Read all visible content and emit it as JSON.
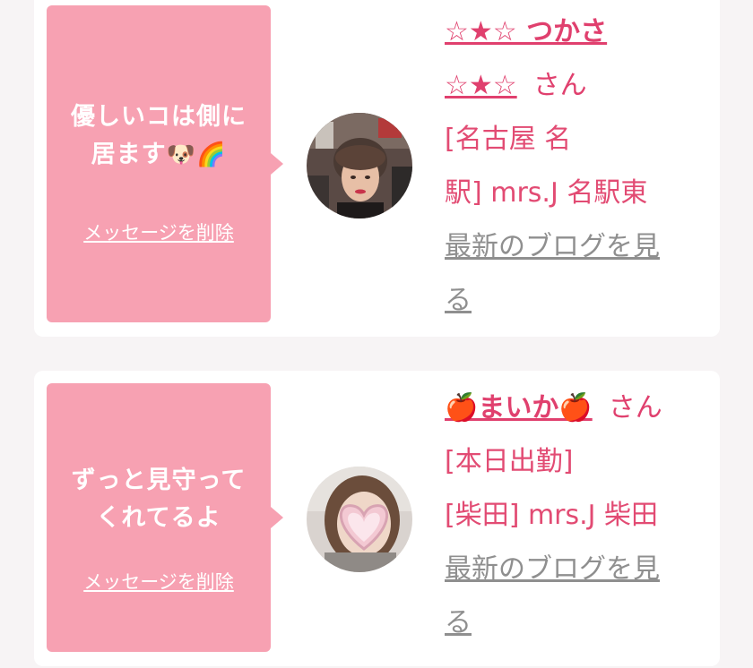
{
  "cards": [
    {
      "message": "優しいコは側に居ます🐶🌈",
      "message_line1": "優しいコは側に",
      "message_line2": "居ます",
      "message_emoji": "🐶🌈",
      "delete_label": "メッセージを削除",
      "name_line1": "☆★☆ つかさ",
      "name_line2": "☆★☆",
      "honorific": "さん",
      "location_line1": "[名古屋 名",
      "location_line2": "駅] mrs.J 名駅東",
      "blog_line1": "最新のブログを見",
      "blog_line2": "る"
    },
    {
      "message": "ずっと見守ってくれてるよ",
      "message_line1": "ずっと見守って",
      "message_line2": "くれてるよ",
      "delete_label": "メッセージを削除",
      "name": "🍎まいか🍎",
      "honorific": "さん",
      "status": "[本日出勤]",
      "location": "[柴田] mrs.J 柴田",
      "blog_line1": "最新のブログを見",
      "blog_line2": "る"
    }
  ]
}
